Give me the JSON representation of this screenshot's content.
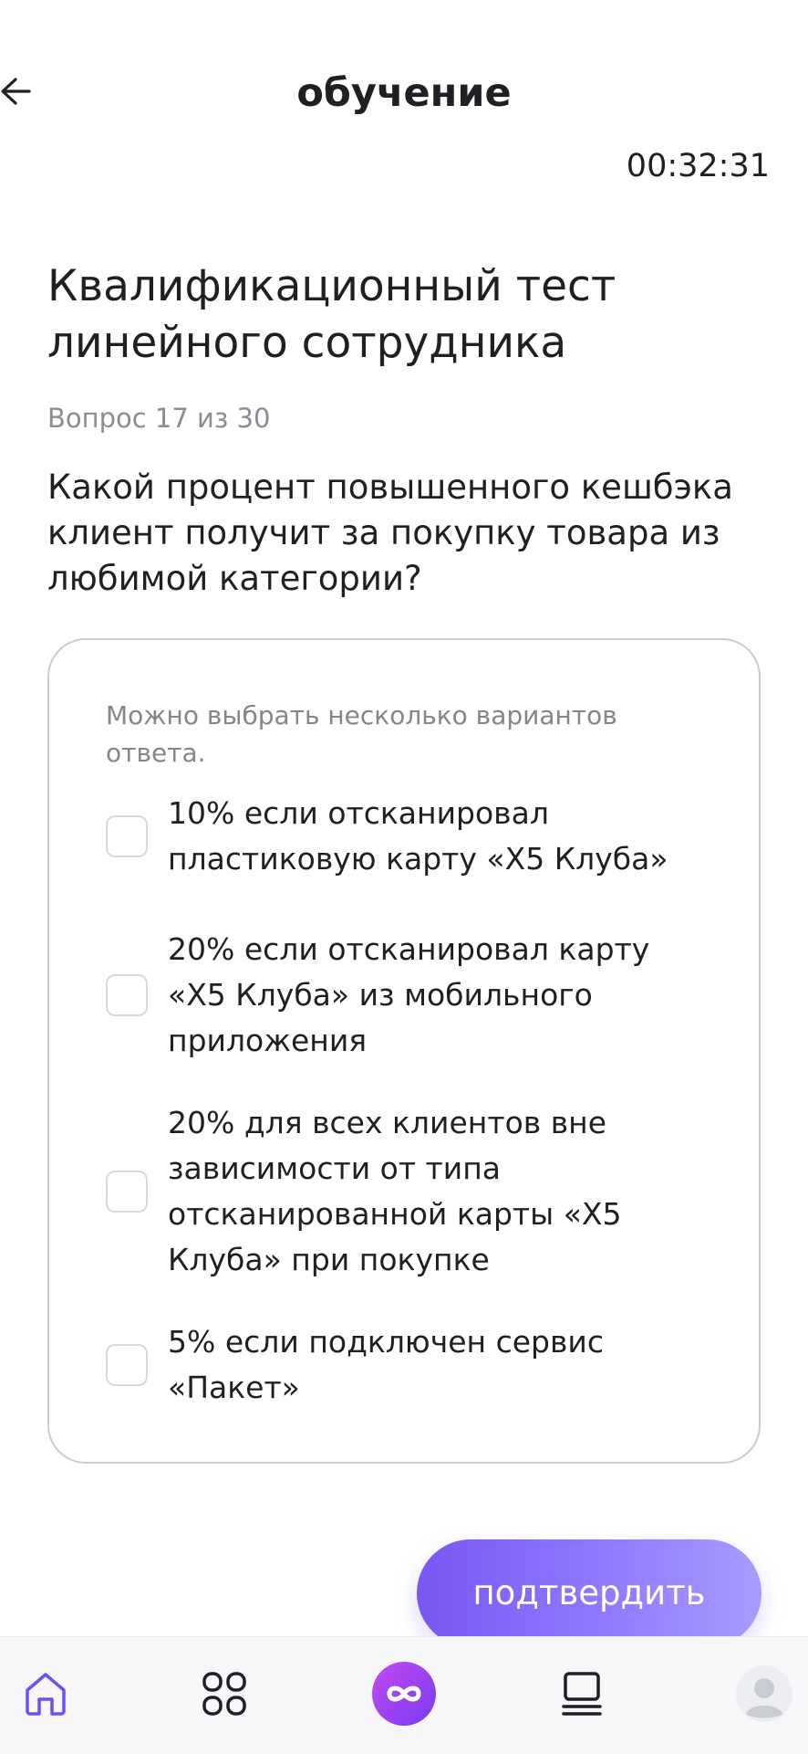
{
  "header": {
    "title": "обучение",
    "timer": "00:32:31"
  },
  "test": {
    "title": "Квалификационный тест линейного сотрудника",
    "counter": "Вопрос 17 из 30",
    "question": "Какой процент повышенного кешбэка клиент получит за покупку товара из любимой категории?"
  },
  "answers": {
    "hint": "Можно выбрать несколько вариантов ответа.",
    "options": [
      {
        "label": "10% если отсканировал пластиковую карту «X5 Клуба»",
        "checked": false
      },
      {
        "label": "20% если отсканировал карту «X5 Клуба» из мобильного приложения",
        "checked": false
      },
      {
        "label": "20% для всех клиентов вне зависимости от типа отсканированной карты «X5 Клуба» при покупке",
        "checked": false
      },
      {
        "label": "5% если подключен сервис «Пакет»",
        "checked": false
      }
    ]
  },
  "confirm_label": "подтвердить",
  "colors": {
    "accent_start": "#7a56f4",
    "accent_end": "#a79bff",
    "home_active": "#6f4ef5",
    "center_badge": "#9b3bf3"
  },
  "nav": {
    "items": [
      {
        "icon": "home-icon",
        "active": true
      },
      {
        "icon": "grid-icon",
        "active": false
      },
      {
        "icon": "infinity-icon",
        "active": false
      },
      {
        "icon": "courses-icon",
        "active": false
      },
      {
        "icon": "avatar",
        "active": false
      }
    ]
  }
}
